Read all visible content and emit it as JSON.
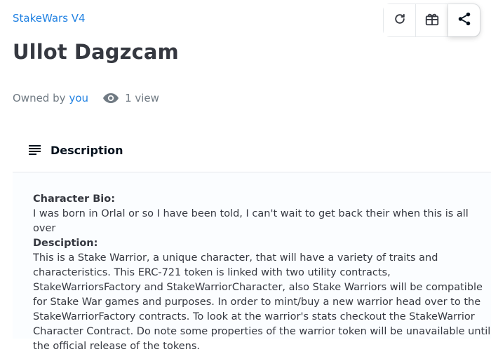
{
  "collection": {
    "name": "StakeWars V4"
  },
  "item": {
    "title": "Ullot Dagzcam"
  },
  "toolbar": {
    "refresh_icon": "refresh-icon",
    "gift_icon": "gift-icon",
    "share_icon": "share-icon"
  },
  "owner": {
    "prefix": "Owned by",
    "name": "you",
    "views": "1 view"
  },
  "description": {
    "header": "Description",
    "bio_heading": "Character Bio:",
    "bio_text": "I was born in Orlal or so I have been told, I can't wait to get back their when this is all over",
    "desc_heading": "Desciption:",
    "desc_text": "This is a Stake Warrior, a unique character, that will have a variety of traits and characteristics. This ERC-721 token is linked with two utility contracts, StakeWarriorsFactory and StakeWarriorCharacter, also Stake Warriors will be compatible for Stake War games and purposes. In order to mint/buy a new warrior head over to the StakeWarriorFactory contracts. To look at the warrior's stats checkout the StakeWarrior Character Contract. Do note some properties of the warrior token will be unavailable until the official release of the tokens."
  },
  "colors": {
    "link": "#2081e2",
    "text": "#353840",
    "muted": "#707a83",
    "border": "#e5e8eb"
  }
}
